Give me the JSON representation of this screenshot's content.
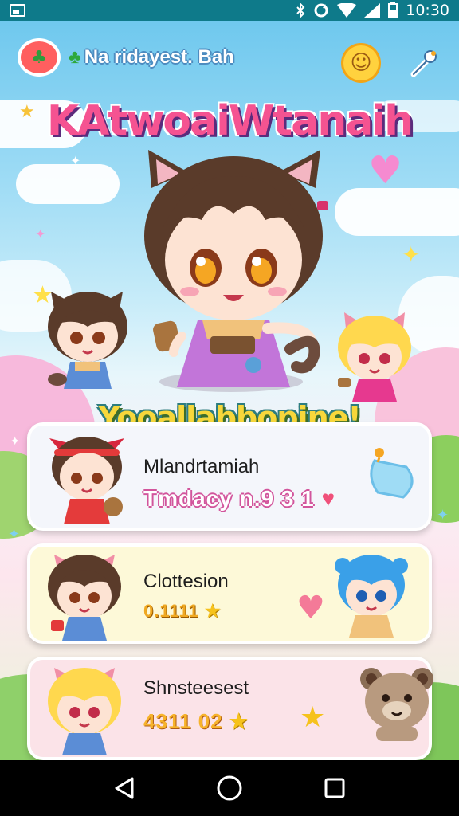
{
  "status_bar": {
    "time": "10:30",
    "icons": [
      "image-icon",
      "bluetooth-icon",
      "sync-icon",
      "wifi-icon",
      "signal-icon",
      "battery-icon"
    ]
  },
  "header": {
    "app_name": "Na ridayest. Bah",
    "logo_icon": "leaf-icon",
    "smile_icon": "smile-icon",
    "tool_icon": "wrench-icon"
  },
  "banner": {
    "title": "KAtwoaiWtanaih"
  },
  "subtitle": {
    "text": "Yooallabbopine!"
  },
  "cards": [
    {
      "title": "Mlandrtamiah",
      "stat": "Tmdacy n.9 3 1",
      "stat_icon": "heart-icon",
      "deco_icon": "bell-icon",
      "bg": "#f4f6fb"
    },
    {
      "title": "Clottesion",
      "stat": "0.1111",
      "stat_icon": "star-icon",
      "deco_icon": "heart-icon",
      "bg": "#fdf9d8"
    },
    {
      "title": "Shnsteesest",
      "stat": "4311 02",
      "stat_icon": "star-icon",
      "deco_icon": "star-icon",
      "bg": "#fbe3e8"
    }
  ],
  "colors": {
    "status_bar": "#0e7a8a",
    "banner": "#f55391",
    "subtitle": "#f7d73b",
    "accent_pink": "#f0507a",
    "accent_star": "#f6c21c"
  },
  "nav": {
    "back_icon": "back-triangle-icon",
    "home_icon": "home-circle-icon",
    "recents_icon": "recents-square-icon"
  }
}
